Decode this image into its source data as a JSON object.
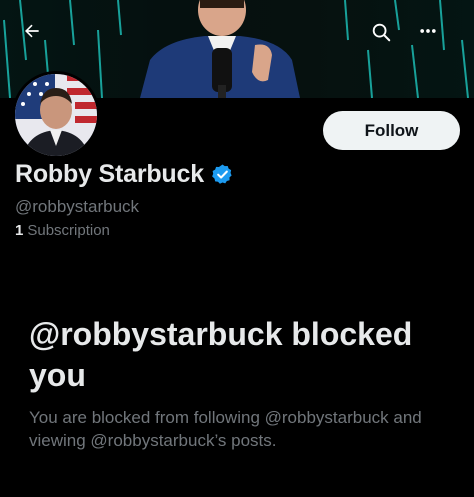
{
  "header": {
    "back_icon": "arrow-left-icon",
    "search_icon": "search-icon",
    "more_icon": "more-horizontal-icon"
  },
  "profile": {
    "display_name": "Robby Starbuck",
    "handle": "@robbystarbuck",
    "subscription_count": "1",
    "subscription_label": "Subscription",
    "verified_color": "#1d9bf0"
  },
  "actions": {
    "follow_label": "Follow"
  },
  "blocked": {
    "title": "@robbystarbuck blocked you",
    "description": "You are blocked from following @robbystarbuck and viewing @robbystarbuck’s posts."
  },
  "colors": {
    "background": "#000000",
    "primary_text": "#e7e9ea",
    "secondary_text": "#71767b",
    "follow_button_bg": "#eff3f4"
  }
}
